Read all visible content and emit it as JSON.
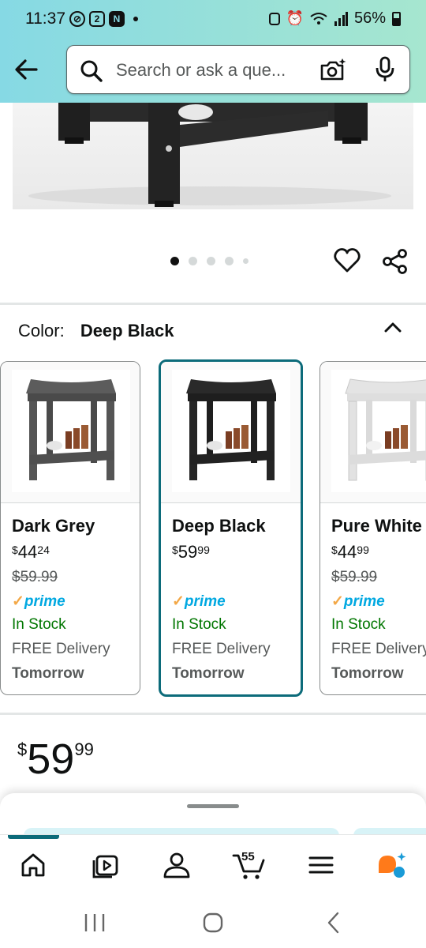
{
  "status_bar": {
    "time": "11:37",
    "battery": "56%"
  },
  "search": {
    "placeholder": "Search or ask a que..."
  },
  "icons": {
    "back": "arrow-left",
    "search": "magnifier",
    "camera": "camera-sparkle",
    "mic": "microphone",
    "wishlist": "heart-outline",
    "share": "share-nodes",
    "collapse": "chevron-up"
  },
  "carousel": {
    "total": 5,
    "active_index": 0
  },
  "color_selector": {
    "label": "Color:",
    "selected": "Deep Black"
  },
  "variants": [
    {
      "name": "Dark Grey",
      "price_symbol": "$",
      "price_whole": "44",
      "price_cents": "24",
      "list_price": "$59.99",
      "prime": "prime",
      "stock": "In Stock",
      "delivery": "FREE Delivery",
      "delivery_day": "Tomorrow",
      "selected": false
    },
    {
      "name": "Deep Black",
      "price_symbol": "$",
      "price_whole": "59",
      "price_cents": "99",
      "list_price": "",
      "prime": "prime",
      "stock": "In Stock",
      "delivery": "FREE Delivery",
      "delivery_day": "Tomorrow",
      "selected": true
    },
    {
      "name": "Pure White",
      "price_symbol": "$",
      "price_whole": "44",
      "price_cents": "99",
      "list_price": "$59.99",
      "prime": "prime",
      "stock": "In Stock",
      "delivery": "FREE Delivery",
      "delivery_day": "Tomorrow",
      "selected": false
    }
  ],
  "price": {
    "symbol": "$",
    "whole": "59",
    "cents": "99"
  },
  "bottom_nav": {
    "items": [
      "home",
      "video",
      "account",
      "cart",
      "menu",
      "rufus"
    ],
    "cart_count": "55",
    "active": "home"
  },
  "colors": {
    "accent": "#0c6b7a",
    "stock_green": "#007600",
    "prime_blue": "#00a8e1",
    "header_gradient_start": "#86d9e4",
    "header_gradient_end": "#a6e6cf"
  }
}
